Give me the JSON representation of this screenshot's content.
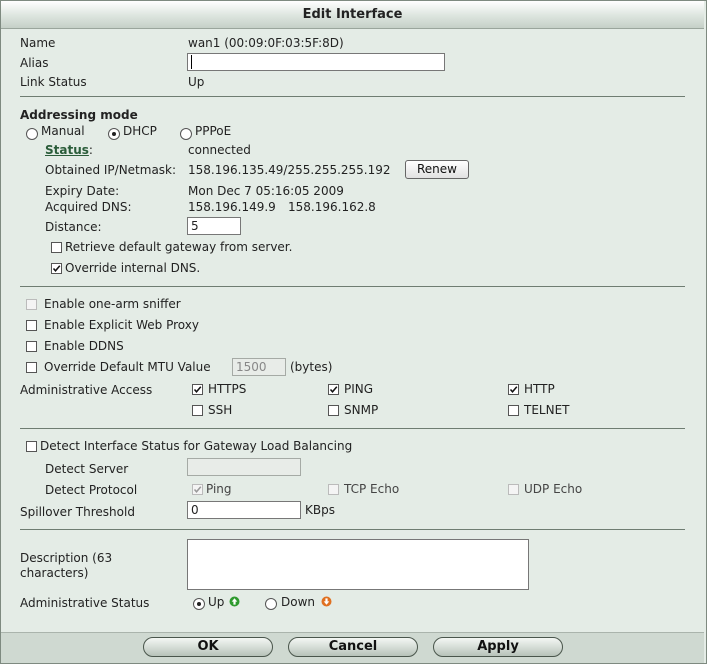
{
  "window": {
    "title": "Edit Interface"
  },
  "info": {
    "name_label": "Name",
    "name_value": "wan1 (00:09:0F:03:5F:8D)",
    "alias_label": "Alias",
    "alias_value": "",
    "link_status_label": "Link Status",
    "link_status_value": "Up"
  },
  "addressing": {
    "heading": "Addressing mode",
    "modes": [
      {
        "label": "Manual",
        "selected": false
      },
      {
        "label": "DHCP",
        "selected": true
      },
      {
        "label": "PPPoE",
        "selected": false
      }
    ],
    "status_label": "Status",
    "status_colon": ":",
    "status_value": "connected",
    "obtained_label": "Obtained IP/Netmask:",
    "obtained_value": "158.196.135.49/255.255.255.192",
    "renew_button": "Renew",
    "expiry_label": "Expiry Date:",
    "expiry_value": "Mon Dec 7 05:16:05 2009",
    "dns_label": "Acquired DNS:",
    "dns_value_1": "158.196.149.9",
    "dns_value_2": "158.196.162.8",
    "distance_label": "Distance:",
    "distance_value": "5",
    "retrieve_gateway_label": "Retrieve default gateway from server.",
    "retrieve_gateway_checked": false,
    "override_dns_label": "Override internal DNS.",
    "override_dns_checked": true
  },
  "options": {
    "one_arm_label": "Enable one-arm sniffer",
    "explicit_proxy_label": "Enable Explicit Web Proxy",
    "ddns_label": "Enable DDNS",
    "mtu_label": "Override Default MTU Value",
    "mtu_value": "1500",
    "mtu_unit": "(bytes)"
  },
  "admin_access": {
    "label": "Administrative Access",
    "items": [
      {
        "label": "HTTPS",
        "checked": true
      },
      {
        "label": "PING",
        "checked": true
      },
      {
        "label": "HTTP",
        "checked": true
      },
      {
        "label": "SSH",
        "checked": false
      },
      {
        "label": "SNMP",
        "checked": false
      },
      {
        "label": "TELNET",
        "checked": false
      }
    ]
  },
  "detect": {
    "label": "Detect Interface Status for Gateway Load Balancing",
    "server_label": "Detect Server",
    "server_value": "",
    "protocol_label": "Detect Protocol",
    "protocols": [
      {
        "label": "Ping",
        "checked": true
      },
      {
        "label": "TCP Echo",
        "checked": false
      },
      {
        "label": "UDP Echo",
        "checked": false
      }
    ],
    "spillover_label": "Spillover Threshold",
    "spillover_value": "0",
    "spillover_unit": "KBps"
  },
  "description": {
    "label_line1": "Description (63",
    "label_line2": "characters)",
    "value": ""
  },
  "admin_status": {
    "label": "Administrative Status",
    "up_label": "Up",
    "down_label": "Down",
    "selected": "Up",
    "up_color": "#2e9a2e",
    "down_color": "#e07020"
  },
  "footer": {
    "ok_label": "OK",
    "cancel_label": "Cancel",
    "apply_label": "Apply"
  }
}
